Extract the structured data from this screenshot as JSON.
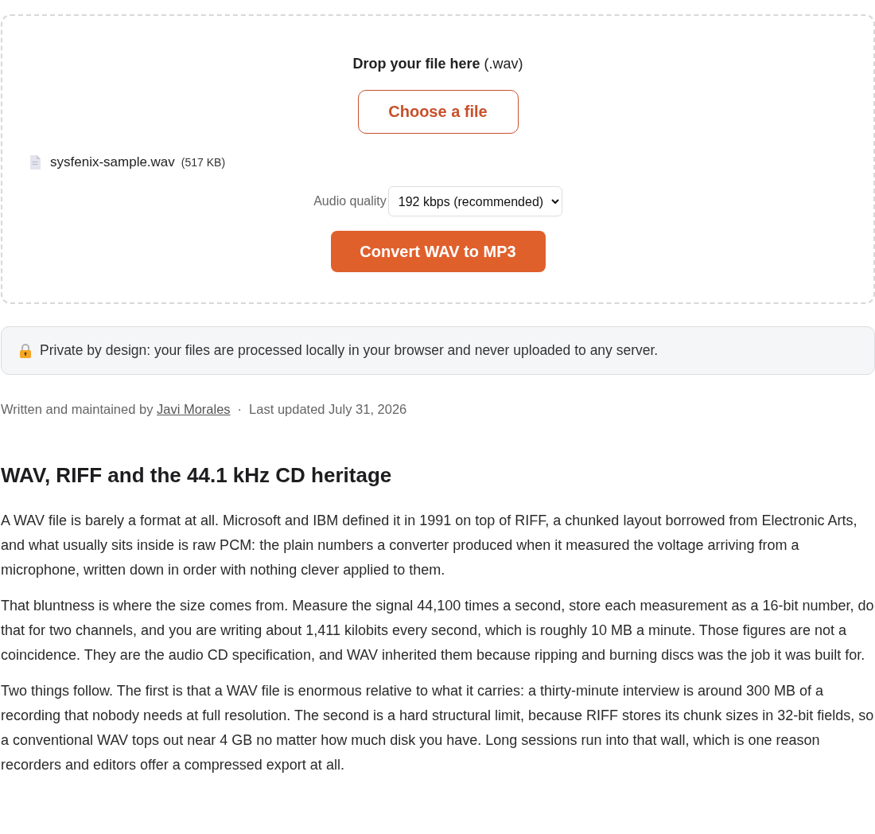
{
  "dropzone": {
    "prompt": "**Drop your file here** (.wav)",
    "choose_button": "Choose a file",
    "file": {
      "name": "sysfenix-sample.wav",
      "size": "(517 KB)"
    },
    "quality": {
      "label": "Audio quality",
      "value": "192 kbps (recommended)"
    },
    "convert_button": "Convert WAV to MP3"
  },
  "privacy_note": "Private by design: your files are processed locally in your browser and never uploaded to any server.",
  "byline": {
    "prefix": "Written and maintained by",
    "author": "Javi Morales",
    "separator": "·",
    "updated": "Last updated July 31, 2026"
  },
  "article": {
    "heading": "WAV, RIFF and the 44.1 kHz CD heritage",
    "paragraphs": [
      "A WAV file is barely a format at all. Microsoft and IBM defined it in 1991 on top of RIFF, a chunked layout borrowed from Electronic Arts, and what usually sits inside is raw PCM: the plain numbers a converter produced when it measured the voltage arriving from a microphone, written down in order with nothing clever applied to them.",
      "That bluntness is where the size comes from. Measure the signal 44,100 times a second, store each measurement as a 16-bit number, do that for two channels, and you are writing about 1,411 kilobits every second, which is roughly 10 MB a minute. Those figures are not a coincidence. They are the audio CD specification, and WAV inherited them because ripping and burning discs was the job it was built for.",
      "Two things follow. The first is that a WAV file is enormous relative to what it carries: a thirty-minute interview is around 300 MB of a recording that nobody needs at full resolution. The second is a hard structural limit, because RIFF stores its chunk sizes in 32-bit fields, so a conventional WAV tops out near 4 GB no matter how much disk you have. Long sessions run into that wall, which is one reason recorders and editors offer a compressed export at all."
    ]
  }
}
